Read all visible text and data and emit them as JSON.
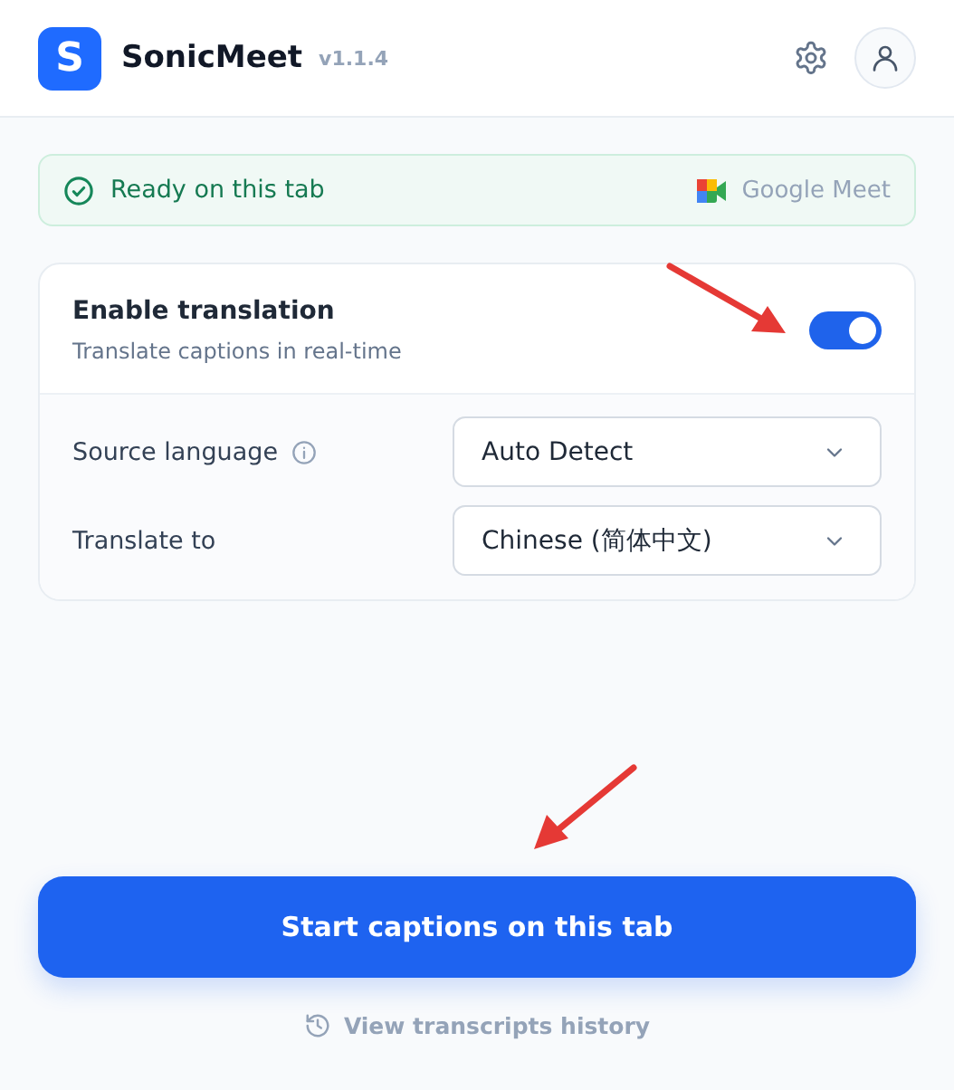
{
  "header": {
    "logo_letter": "S",
    "app_name": "SonicMeet",
    "version": "v1.1.4"
  },
  "status": {
    "text": "Ready on this tab",
    "platform": "Google Meet"
  },
  "translation": {
    "title": "Enable translation",
    "subtitle": "Translate captions in real-time",
    "on": true,
    "fields": [
      {
        "label": "Source language",
        "info": true,
        "value": "Auto Detect"
      },
      {
        "label": "Translate to",
        "info": false,
        "value": "Chinese (简体中文)"
      }
    ]
  },
  "primary_button": "Start captions on this tab",
  "history_link": "View transcripts history"
}
